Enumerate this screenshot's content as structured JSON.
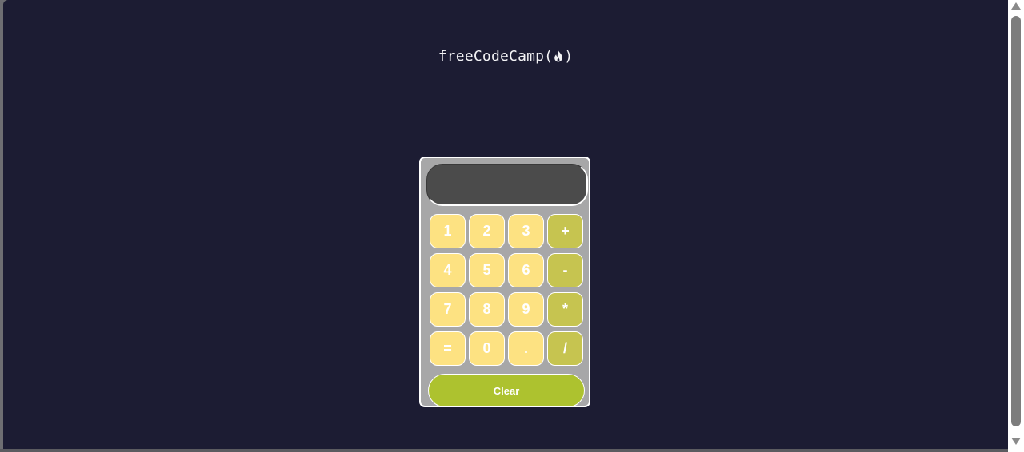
{
  "brand": {
    "text_left": "freeCodeCamp(",
    "text_right": ")",
    "icon": "flame-icon"
  },
  "display": {
    "value": ""
  },
  "keypad": {
    "keys": [
      {
        "label": "1",
        "type": "digit"
      },
      {
        "label": "2",
        "type": "digit"
      },
      {
        "label": "3",
        "type": "digit"
      },
      {
        "label": "+",
        "type": "operator"
      },
      {
        "label": "4",
        "type": "digit"
      },
      {
        "label": "5",
        "type": "digit"
      },
      {
        "label": "6",
        "type": "digit"
      },
      {
        "label": "-",
        "type": "operator"
      },
      {
        "label": "7",
        "type": "digit"
      },
      {
        "label": "8",
        "type": "digit"
      },
      {
        "label": "9",
        "type": "digit"
      },
      {
        "label": "*",
        "type": "operator"
      },
      {
        "label": "=",
        "type": "digit"
      },
      {
        "label": "0",
        "type": "digit"
      },
      {
        "label": ".",
        "type": "digit"
      },
      {
        "label": "/",
        "type": "operator"
      }
    ],
    "clear_label": "Clear"
  },
  "colors": {
    "background": "#1c1c33",
    "calculator_body": "#a7a7a8",
    "display": "#4b4b4b",
    "digit_key": "#fde282",
    "operator_key": "#c6c450",
    "clear_button": "#adc22f"
  }
}
